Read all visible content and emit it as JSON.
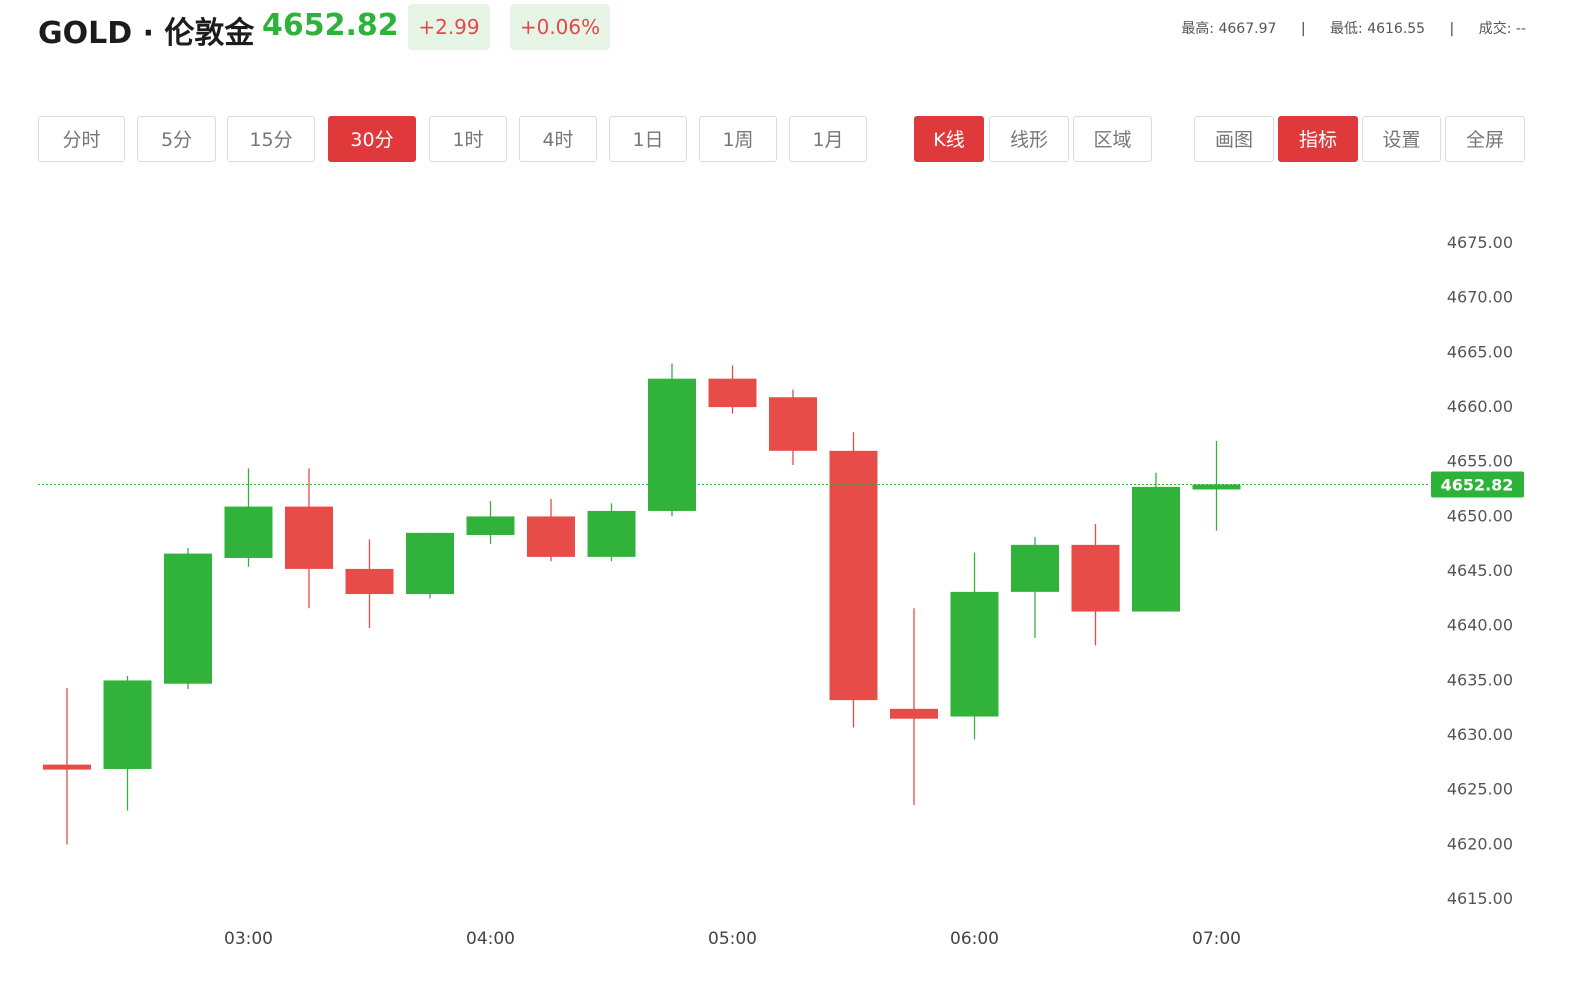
{
  "header": {
    "symbol": "GOLD · 伦敦金",
    "price": "4652.82",
    "change": "+2.99",
    "change_pct": "+0.06%",
    "high_label": "最高:",
    "high_value": "4667.97",
    "low_label": "最低:",
    "low_value": "4616.55",
    "volume_label": "成交:",
    "volume_value": "--",
    "separator": "|",
    "price_color": "#2db33a",
    "change_color": "#e5484a"
  },
  "toolbar": {
    "periods": [
      {
        "label": "分时",
        "active": false
      },
      {
        "label": "5分",
        "active": false
      },
      {
        "label": "15分",
        "active": false
      },
      {
        "label": "30分",
        "active": true
      },
      {
        "label": "1时",
        "active": false
      },
      {
        "label": "4时",
        "active": false
      },
      {
        "label": "1日",
        "active": false
      },
      {
        "label": "1周",
        "active": false
      },
      {
        "label": "1月",
        "active": false
      }
    ],
    "chart_types": [
      {
        "label": "K线",
        "active": true
      },
      {
        "label": "线形",
        "active": false
      },
      {
        "label": "区域",
        "active": false
      }
    ],
    "tools": [
      {
        "label": "画图",
        "active": false
      },
      {
        "label": "指标",
        "active": true
      },
      {
        "label": "设置",
        "active": false
      },
      {
        "label": "全屏",
        "active": false
      }
    ],
    "active_color": "#e0393b"
  },
  "chart_data": {
    "type": "candlestick",
    "colors": {
      "up": "#31b33b",
      "down": "#e84c49",
      "last_price_line": "#2db33a"
    },
    "ylim": [
      4613.5,
      4677.5
    ],
    "y_ticks": [
      "4675.00",
      "4670.00",
      "4665.00",
      "4660.00",
      "4655.00",
      "4650.00",
      "4645.00",
      "4640.00",
      "4635.00",
      "4630.00",
      "4625.00",
      "4620.00",
      "4615.00"
    ],
    "x_tick_labels": [
      {
        "label": "03:00",
        "index": 3
      },
      {
        "label": "04:00",
        "index": 7
      },
      {
        "label": "05:00",
        "index": 11
      },
      {
        "label": "06:00",
        "index": 15
      },
      {
        "label": "07:00",
        "index": 19
      }
    ],
    "last_price": 4652.82,
    "last_price_label": "4652.82",
    "candles": [
      {
        "open": 4627.2,
        "close": 4626.8,
        "high": 4634.2,
        "low": 4619.9
      },
      {
        "open": 4626.8,
        "close": 4634.9,
        "high": 4635.3,
        "low": 4623.0
      },
      {
        "open": 4634.6,
        "close": 4646.5,
        "high": 4647.0,
        "low": 4634.1
      },
      {
        "open": 4646.1,
        "close": 4650.8,
        "high": 4654.3,
        "low": 4645.3
      },
      {
        "open": 4650.8,
        "close": 4645.1,
        "high": 4654.3,
        "low": 4641.5
      },
      {
        "open": 4645.1,
        "close": 4642.8,
        "high": 4647.8,
        "low": 4639.7
      },
      {
        "open": 4642.8,
        "close": 4648.4,
        "high": 4648.4,
        "low": 4642.4
      },
      {
        "open": 4648.2,
        "close": 4649.9,
        "high": 4651.3,
        "low": 4647.4
      },
      {
        "open": 4649.9,
        "close": 4646.2,
        "high": 4651.5,
        "low": 4645.8
      },
      {
        "open": 4646.2,
        "close": 4650.4,
        "high": 4651.1,
        "low": 4645.8
      },
      {
        "open": 4650.4,
        "close": 4662.5,
        "high": 4663.9,
        "low": 4649.9
      },
      {
        "open": 4662.5,
        "close": 4659.9,
        "high": 4663.7,
        "low": 4659.3
      },
      {
        "open": 4660.8,
        "close": 4655.9,
        "high": 4661.5,
        "low": 4654.6
      },
      {
        "open": 4655.9,
        "close": 4633.1,
        "high": 4657.6,
        "low": 4630.6
      },
      {
        "open": 4632.3,
        "close": 4631.4,
        "high": 4641.5,
        "low": 4623.5
      },
      {
        "open": 4631.6,
        "close": 4643.0,
        "high": 4646.6,
        "low": 4629.5
      },
      {
        "open": 4643.0,
        "close": 4647.3,
        "high": 4648.0,
        "low": 4638.8
      },
      {
        "open": 4647.3,
        "close": 4641.2,
        "high": 4649.2,
        "low": 4638.1
      },
      {
        "open": 4641.2,
        "close": 4652.6,
        "high": 4653.9,
        "low": 4641.2
      },
      {
        "open": 4652.4,
        "close": 4652.82,
        "high": 4656.8,
        "low": 4648.6
      }
    ]
  }
}
